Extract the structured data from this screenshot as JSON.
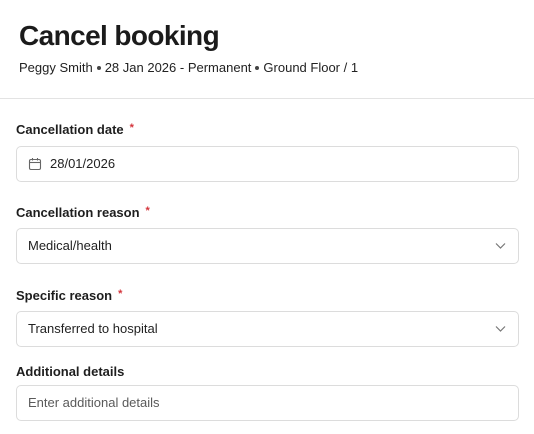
{
  "header": {
    "title": "Cancel booking",
    "guest": "Peggy Smith",
    "booking": "28 Jan 2026 - Permanent",
    "location": "Ground Floor / 1"
  },
  "form": {
    "cancellation_date": {
      "label": "Cancellation date",
      "required": "*",
      "value": "28/01/2026",
      "icon": "calendar-icon"
    },
    "cancellation_reason": {
      "label": "Cancellation reason",
      "required": "*",
      "value": "Medical/health",
      "icon": "chevron-down-icon"
    },
    "specific_reason": {
      "label": "Specific reason",
      "required": "*",
      "value": "Transferred to hospital",
      "icon": "chevron-down-icon"
    },
    "additional_details": {
      "label": "Additional details",
      "placeholder": "Enter additional details"
    }
  },
  "colors": {
    "required": "#d4343b",
    "border": "#dcdcdc",
    "divider": "#e3e3e3"
  }
}
